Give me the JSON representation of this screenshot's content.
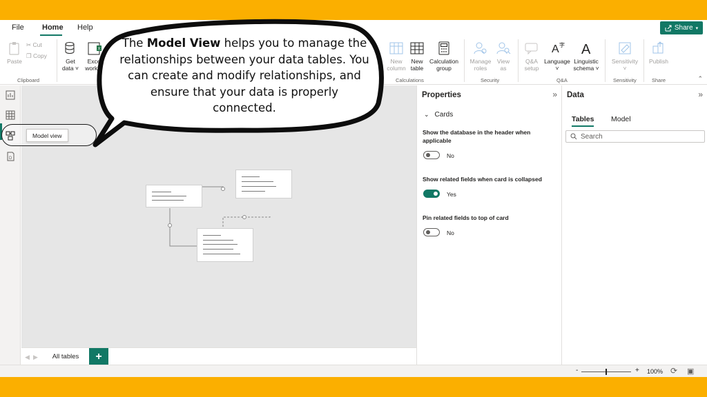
{
  "menubar": {
    "items": [
      "File",
      "Home",
      "Help"
    ],
    "active": "Home",
    "share_label": "Share"
  },
  "ribbon": {
    "clipboard": {
      "paste": "Paste",
      "cut": "Cut",
      "copy": "Copy",
      "group": "Clipboard"
    },
    "data": {
      "get_data_1": "Get",
      "get_data_2": "data",
      "excel_1": "Excel",
      "excel_2": "workbo"
    },
    "calculations": {
      "new_column_1": "New",
      "new_column_2": "column",
      "new_table_1": "New",
      "new_table_2": "table",
      "calc_group_1": "Calculation",
      "calc_group_2": "group",
      "group": "Calculations"
    },
    "security": {
      "manage_roles_1": "Manage",
      "manage_roles_2": "roles",
      "view_as_1": "View",
      "view_as_2": "as",
      "group": "Security"
    },
    "qa": {
      "qa_setup_1": "Q&A",
      "qa_setup_2": "setup",
      "language": "Language",
      "linguistic_1": "Linguistic",
      "linguistic_2": "schema",
      "group": "Q&A"
    },
    "sensitivity": {
      "label": "Sensitivity",
      "group": "Sensitivity"
    },
    "share": {
      "publish": "Publish",
      "group": "Share"
    }
  },
  "left_rail": {
    "items": [
      "report-view",
      "table-view",
      "model-view",
      "dax-query-view"
    ],
    "active": "model-view",
    "tooltip": "Model view"
  },
  "callout": {
    "prefix": "The ",
    "bold": "Model View",
    "suffix": " helps you to manage the relationships between your data tables. You can create and modify relationships, and ensure that your data is properly connected."
  },
  "properties": {
    "title": "Properties",
    "section": "Cards",
    "settings": [
      {
        "label": "Show the database in the header when applicable",
        "value": "No",
        "on": false
      },
      {
        "label": "Show related fields when card is collapsed",
        "value": "Yes",
        "on": true
      },
      {
        "label": "Pin related fields to top of card",
        "value": "No",
        "on": false
      }
    ]
  },
  "data_pane": {
    "title": "Data",
    "tabs": [
      "Tables",
      "Model"
    ],
    "active_tab": "Tables",
    "search_placeholder": "Search"
  },
  "tabs": {
    "all_tables": "All tables",
    "add": "+"
  },
  "status": {
    "zoom": "100%",
    "minus": "-",
    "plus": "+"
  },
  "colors": {
    "accent": "#117865",
    "frame": "#FBAF00"
  }
}
